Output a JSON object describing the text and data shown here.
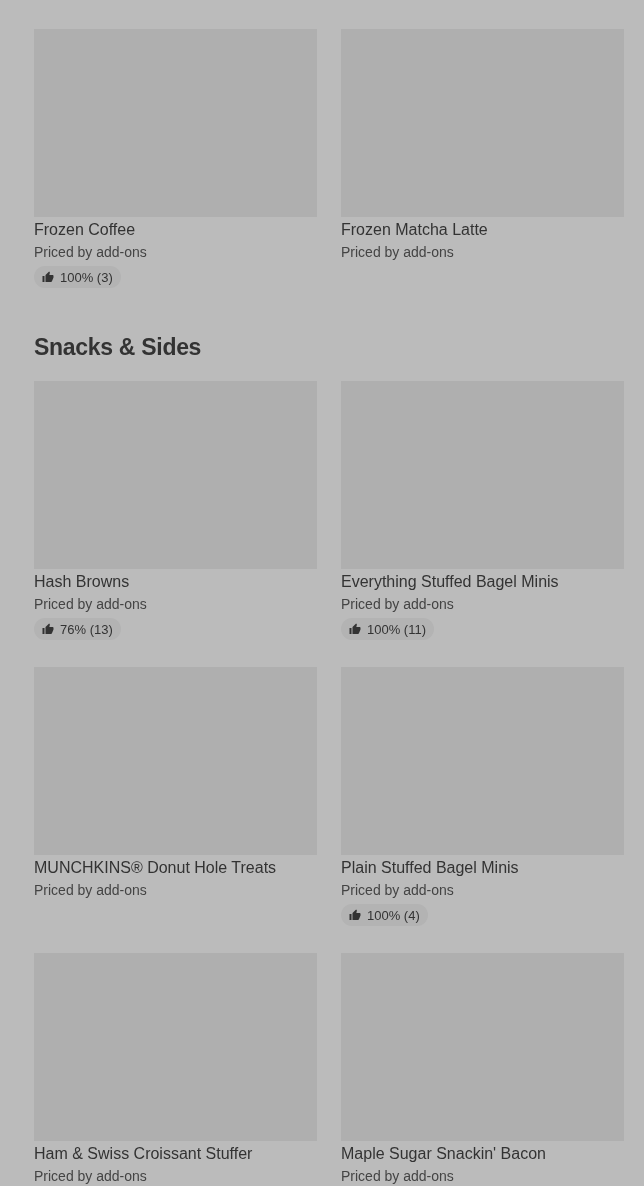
{
  "sections": [
    {
      "items": [
        {
          "name": "Frozen Coffee",
          "price": "Priced by add-ons",
          "rating": "100% (3)"
        },
        {
          "name": "Frozen Matcha Latte",
          "price": "Priced by add-ons"
        }
      ]
    },
    {
      "heading": "Snacks & Sides",
      "items": [
        {
          "name": "Hash Browns",
          "price": "Priced by add-ons",
          "rating": "76% (13)"
        },
        {
          "name": "Everything Stuffed Bagel Minis",
          "price": "Priced by add-ons",
          "rating": "100% (11)"
        },
        {
          "name": "MUNCHKINS® Donut Hole Treats",
          "price": "Priced by add-ons"
        },
        {
          "name": "Plain Stuffed Bagel Minis",
          "price": "Priced by add-ons",
          "rating": "100% (4)"
        },
        {
          "name": "Ham & Swiss Croissant Stuffer",
          "price": "Priced by add-ons"
        },
        {
          "name": "Maple Sugar Snackin' Bacon",
          "price": "Priced by add-ons"
        }
      ]
    }
  ]
}
